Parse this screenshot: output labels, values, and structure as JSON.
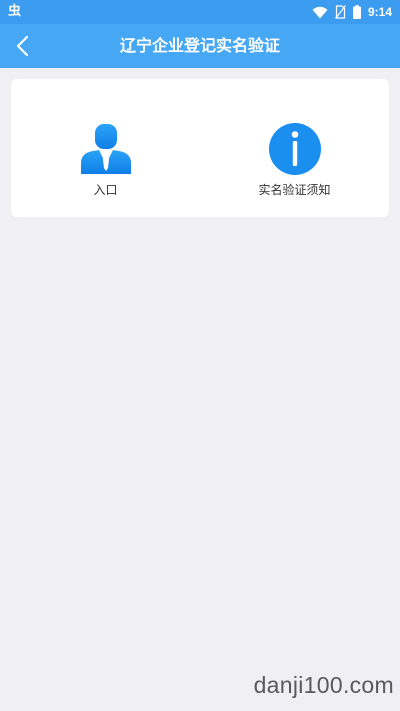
{
  "status_bar": {
    "left_icon": "虫",
    "time": "9:14",
    "icons": [
      "wifi-icon",
      "no-sim-icon",
      "battery-icon"
    ]
  },
  "header": {
    "title": "辽宁企业登记实名验证",
    "back_icon": "chevron-left-icon"
  },
  "card": {
    "items": [
      {
        "label": "入口",
        "icon": "user-icon"
      },
      {
        "label": "实名验证须知",
        "icon": "info-icon"
      }
    ]
  },
  "watermark": "danji100.com",
  "colors": {
    "accent": "#46a7f4",
    "icon_blue": "#1a8ff0",
    "background": "#efeff4"
  }
}
